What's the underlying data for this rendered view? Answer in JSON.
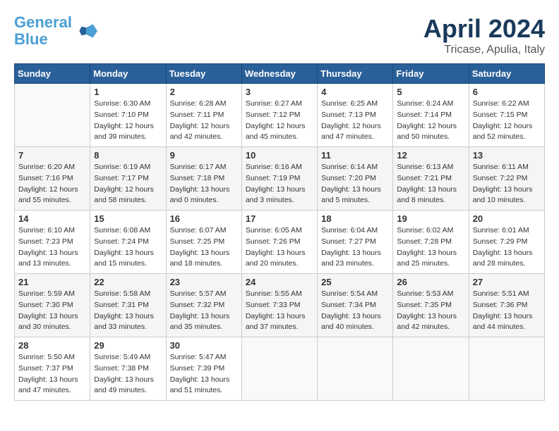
{
  "header": {
    "logo_line1": "General",
    "logo_line2": "Blue",
    "month_title": "April 2024",
    "subtitle": "Tricase, Apulia, Italy"
  },
  "days_header": [
    "Sunday",
    "Monday",
    "Tuesday",
    "Wednesday",
    "Thursday",
    "Friday",
    "Saturday"
  ],
  "weeks": [
    [
      {
        "day": "",
        "info": ""
      },
      {
        "day": "1",
        "info": "Sunrise: 6:30 AM\nSunset: 7:10 PM\nDaylight: 12 hours\nand 39 minutes."
      },
      {
        "day": "2",
        "info": "Sunrise: 6:28 AM\nSunset: 7:11 PM\nDaylight: 12 hours\nand 42 minutes."
      },
      {
        "day": "3",
        "info": "Sunrise: 6:27 AM\nSunset: 7:12 PM\nDaylight: 12 hours\nand 45 minutes."
      },
      {
        "day": "4",
        "info": "Sunrise: 6:25 AM\nSunset: 7:13 PM\nDaylight: 12 hours\nand 47 minutes."
      },
      {
        "day": "5",
        "info": "Sunrise: 6:24 AM\nSunset: 7:14 PM\nDaylight: 12 hours\nand 50 minutes."
      },
      {
        "day": "6",
        "info": "Sunrise: 6:22 AM\nSunset: 7:15 PM\nDaylight: 12 hours\nand 52 minutes."
      }
    ],
    [
      {
        "day": "7",
        "info": "Sunrise: 6:20 AM\nSunset: 7:16 PM\nDaylight: 12 hours\nand 55 minutes."
      },
      {
        "day": "8",
        "info": "Sunrise: 6:19 AM\nSunset: 7:17 PM\nDaylight: 12 hours\nand 58 minutes."
      },
      {
        "day": "9",
        "info": "Sunrise: 6:17 AM\nSunset: 7:18 PM\nDaylight: 13 hours\nand 0 minutes."
      },
      {
        "day": "10",
        "info": "Sunrise: 6:16 AM\nSunset: 7:19 PM\nDaylight: 13 hours\nand 3 minutes."
      },
      {
        "day": "11",
        "info": "Sunrise: 6:14 AM\nSunset: 7:20 PM\nDaylight: 13 hours\nand 5 minutes."
      },
      {
        "day": "12",
        "info": "Sunrise: 6:13 AM\nSunset: 7:21 PM\nDaylight: 13 hours\nand 8 minutes."
      },
      {
        "day": "13",
        "info": "Sunrise: 6:11 AM\nSunset: 7:22 PM\nDaylight: 13 hours\nand 10 minutes."
      }
    ],
    [
      {
        "day": "14",
        "info": "Sunrise: 6:10 AM\nSunset: 7:23 PM\nDaylight: 13 hours\nand 13 minutes."
      },
      {
        "day": "15",
        "info": "Sunrise: 6:08 AM\nSunset: 7:24 PM\nDaylight: 13 hours\nand 15 minutes."
      },
      {
        "day": "16",
        "info": "Sunrise: 6:07 AM\nSunset: 7:25 PM\nDaylight: 13 hours\nand 18 minutes."
      },
      {
        "day": "17",
        "info": "Sunrise: 6:05 AM\nSunset: 7:26 PM\nDaylight: 13 hours\nand 20 minutes."
      },
      {
        "day": "18",
        "info": "Sunrise: 6:04 AM\nSunset: 7:27 PM\nDaylight: 13 hours\nand 23 minutes."
      },
      {
        "day": "19",
        "info": "Sunrise: 6:02 AM\nSunset: 7:28 PM\nDaylight: 13 hours\nand 25 minutes."
      },
      {
        "day": "20",
        "info": "Sunrise: 6:01 AM\nSunset: 7:29 PM\nDaylight: 13 hours\nand 28 minutes."
      }
    ],
    [
      {
        "day": "21",
        "info": "Sunrise: 5:59 AM\nSunset: 7:30 PM\nDaylight: 13 hours\nand 30 minutes."
      },
      {
        "day": "22",
        "info": "Sunrise: 5:58 AM\nSunset: 7:31 PM\nDaylight: 13 hours\nand 33 minutes."
      },
      {
        "day": "23",
        "info": "Sunrise: 5:57 AM\nSunset: 7:32 PM\nDaylight: 13 hours\nand 35 minutes."
      },
      {
        "day": "24",
        "info": "Sunrise: 5:55 AM\nSunset: 7:33 PM\nDaylight: 13 hours\nand 37 minutes."
      },
      {
        "day": "25",
        "info": "Sunrise: 5:54 AM\nSunset: 7:34 PM\nDaylight: 13 hours\nand 40 minutes."
      },
      {
        "day": "26",
        "info": "Sunrise: 5:53 AM\nSunset: 7:35 PM\nDaylight: 13 hours\nand 42 minutes."
      },
      {
        "day": "27",
        "info": "Sunrise: 5:51 AM\nSunset: 7:36 PM\nDaylight: 13 hours\nand 44 minutes."
      }
    ],
    [
      {
        "day": "28",
        "info": "Sunrise: 5:50 AM\nSunset: 7:37 PM\nDaylight: 13 hours\nand 47 minutes."
      },
      {
        "day": "29",
        "info": "Sunrise: 5:49 AM\nSunset: 7:38 PM\nDaylight: 13 hours\nand 49 minutes."
      },
      {
        "day": "30",
        "info": "Sunrise: 5:47 AM\nSunset: 7:39 PM\nDaylight: 13 hours\nand 51 minutes."
      },
      {
        "day": "",
        "info": ""
      },
      {
        "day": "",
        "info": ""
      },
      {
        "day": "",
        "info": ""
      },
      {
        "day": "",
        "info": ""
      }
    ]
  ]
}
